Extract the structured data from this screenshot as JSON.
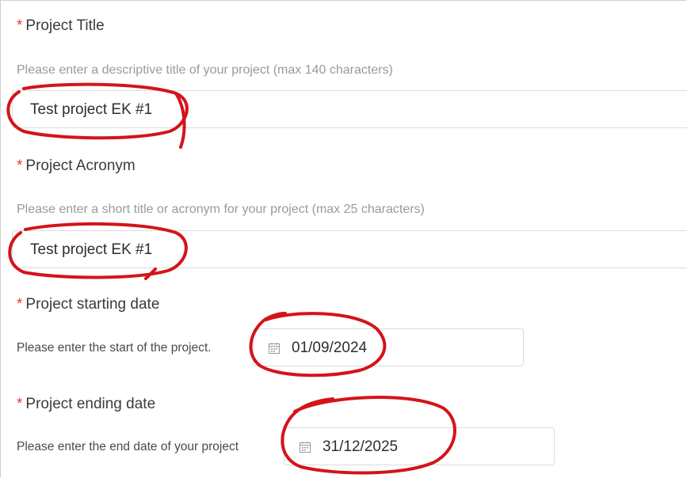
{
  "form": {
    "project_title": {
      "label": "Project Title",
      "hint": "Please enter a descriptive title of your project (max 140 characters)",
      "value": "Test project EK #1"
    },
    "project_acronym": {
      "label": "Project Acronym",
      "hint": "Please enter a short title or acronym for your project (max 25 characters)",
      "value": "Test project EK #1"
    },
    "start_date": {
      "label": "Project starting date",
      "hint": "Please enter the start of the project.",
      "value": "01/09/2024"
    },
    "end_date": {
      "label": "Project ending date",
      "hint": "Please enter the end date of your project",
      "value": "31/12/2025"
    },
    "required_marker": "*"
  },
  "colors": {
    "required": "#e53935",
    "annotation": "#d3141a",
    "field_border": "#dcdcdc",
    "hint_text": "#9a9a9a"
  }
}
